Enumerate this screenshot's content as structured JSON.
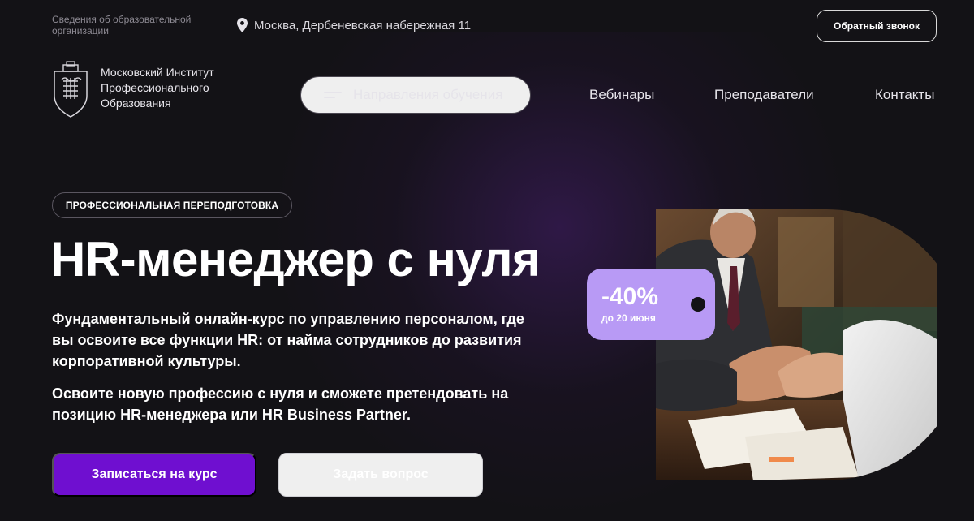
{
  "header": {
    "info_link": "Сведения об образовательной организации",
    "address": "Москва, Дербеневская набережная 11",
    "callback_button": "Обратный звонок"
  },
  "logo": {
    "name": "Московский Институт Профессионального Образования"
  },
  "nav": {
    "directions": "Направления обучения",
    "webinars": "Вебинары",
    "teachers": "Преподаватели",
    "contacts": "Контакты"
  },
  "hero": {
    "badge": "ПРОФЕССИОНАЛЬНАЯ ПЕРЕПОДГОТОВКА",
    "title": "HR-менеджер с нуля",
    "description_1": "Фундаментальный онлайн-курс по управлению персоналом, где вы освоите все функции HR: от найма сотрудников до развития корпоративной культуры.",
    "description_2": "Освоите новую профессию с нуля и сможете претендовать на позицию HR-менеджера или HR Business Partner.",
    "primary_button": "Записаться на курс",
    "secondary_button": "Задать вопрос"
  },
  "discount": {
    "percent": "-40%",
    "until": "до 20 июня"
  },
  "icons": {
    "address": "location-pin-icon",
    "menu": "menu-icon",
    "logo": "institute-emblem-icon"
  },
  "colors": {
    "background": "#131216",
    "primary_button": "#6f0fd0",
    "discount_tag": "#b89af5"
  }
}
